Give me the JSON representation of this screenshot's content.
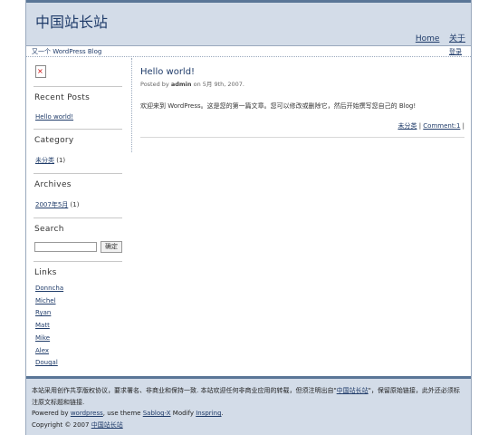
{
  "site": {
    "title": "中国站长站",
    "tagline": "又一个 WordPress Blog"
  },
  "nav": {
    "home": "Home",
    "about": "关于",
    "login": "登录"
  },
  "sidebar": {
    "recent_posts": {
      "title": "Recent Posts",
      "items": [
        "Hello world!"
      ]
    },
    "category": {
      "title": "Category",
      "link": "未分类",
      "count": "(1)"
    },
    "archives": {
      "title": "Archives",
      "link": "2007年5月",
      "count": "(1)"
    },
    "search": {
      "title": "Search",
      "button": "确定",
      "value": ""
    },
    "links": {
      "title": "Links",
      "items": [
        "Donncha",
        "Michel",
        "Ryan",
        "Matt",
        "Mike",
        "Alex",
        "Dougal"
      ]
    }
  },
  "post": {
    "title": "Hello world!",
    "meta_prefix": "Posted by",
    "author": "admin",
    "date": "on 5月 9th, 2007.",
    "body": "欢迎来到 WordPress。这是您的第一篇文章。您可以修改或删除它，然后开始撰写您自己的 Blog!",
    "category": "未分类",
    "comments": "Comment:1"
  },
  "footer": {
    "line1_a": "本站采用创作共享版权协议，要求署名、非商业和保持一致. 本站欢迎任何非商业应用的转载，但须注明出自\"",
    "line1_link": "中国站长站",
    "line1_b": "\"，保留原始链接，此外还必须标注原文标题和链接.",
    "powered_prefix": "Powered by",
    "powered_link": "wordpress",
    "theme_prefix": ", use theme",
    "theme_link": "Sablog-X",
    "modify_prefix": "Modify",
    "modify_link": "Inspring",
    "copyright_prefix": "Copyright © 2007",
    "copyright_link": "中国站长站"
  }
}
